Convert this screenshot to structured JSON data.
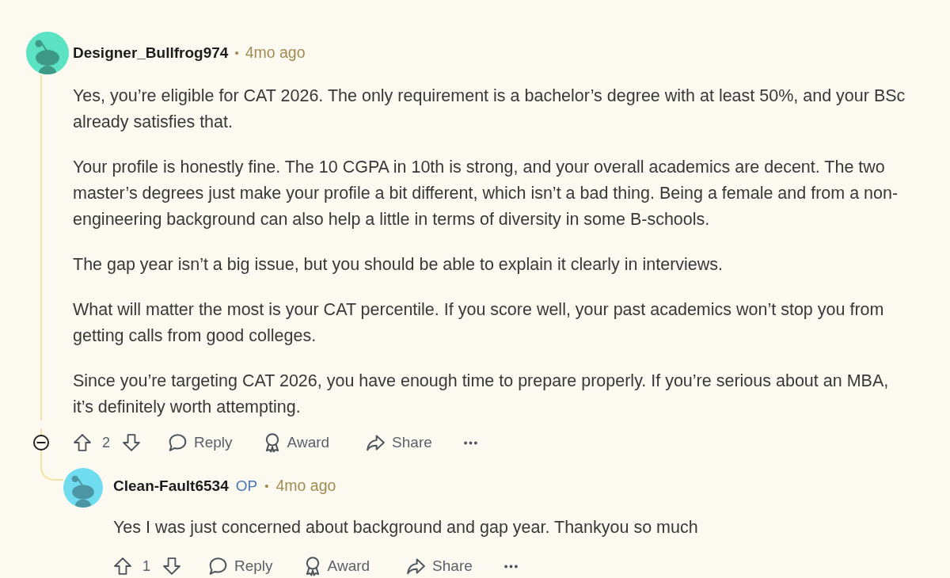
{
  "comments": [
    {
      "author": "Designer_Bullfrog974",
      "separator": "•",
      "time": "4mo ago",
      "color": "#5ce3c4",
      "paragraphs": [
        "Yes, you’re eligible for CAT 2026. The only requirement is a bachelor’s degree with at least 50%, and your BSc already satisfies that.",
        "Your profile is honestly fine. The 10 CGPA in 10th is strong, and your overall academics are decent. The two master’s degrees just make your profile a bit different, which isn’t a bad thing. Being a female and from a non-engineering background can also help a little in terms of diversity in some B-schools.",
        "The gap year isn’t a big issue, but you should be able to explain it clearly in interviews.",
        "What will matter the most is your CAT percentile. If you score well, your past academics won’t stop you from getting calls from good colleges.",
        "Since you’re targeting CAT 2026, you have enough time to prepare properly. If you’re serious about an MBA, it’s definitely worth attempting."
      ],
      "votes": "2",
      "actions": [
        {
          "kind": "reply",
          "label": "Reply"
        },
        {
          "kind": "award",
          "label": "Award"
        },
        {
          "kind": "share",
          "label": "Share"
        }
      ],
      "expanded": true,
      "replies": [
        {
          "author": "Clean-Fault6534",
          "badge": "OP",
          "separator": "•",
          "time": "4mo ago",
          "color": "#70dcef",
          "paragraphs": [
            "Yes I was just concerned about background and gap year. Thankyou so much"
          ],
          "votes": "1",
          "actions": [
            {
              "kind": "reply",
              "label": "Reply"
            },
            {
              "kind": "award",
              "label": "Award"
            },
            {
              "kind": "share",
              "label": "Share"
            }
          ]
        }
      ]
    }
  ]
}
